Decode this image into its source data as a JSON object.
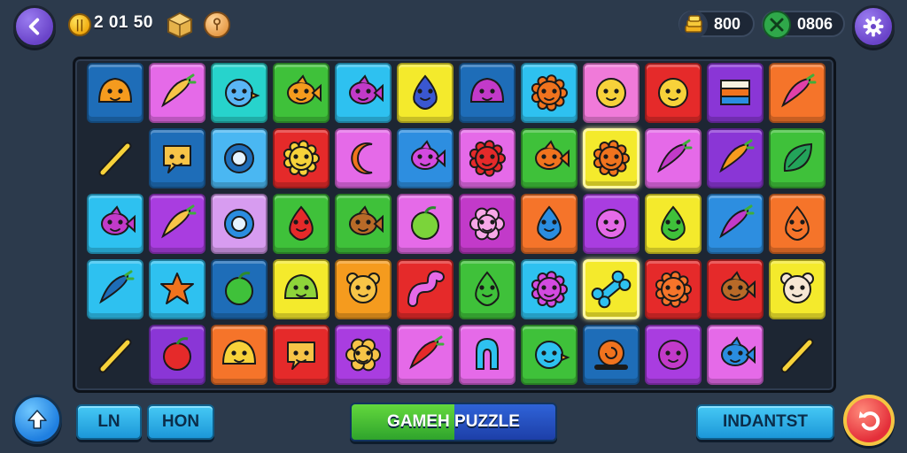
{
  "header": {
    "score": "2 01 50",
    "gems": "800",
    "energy": "0806",
    "coin_icon": "coin-icon",
    "box_icon": "treasure-box-icon",
    "key_icon": "key-coin-icon"
  },
  "buttons": {
    "ln": "LN",
    "hon": "HON",
    "puzzle": "GAMEH PUZZLE",
    "instant": "INDANTST"
  },
  "colors": {
    "accent_purple": "#6a44c9",
    "board": "#1d2633",
    "background": "#2c3a4c"
  },
  "board": {
    "rows": 5,
    "cols": 12,
    "tiles": [
      [
        {
          "c": "#1e6db8",
          "i": "blob",
          "f": "#f59b1e"
        },
        {
          "c": "#e56ae8",
          "i": "carrot",
          "f": "#f7c447"
        },
        {
          "c": "#27d3cc",
          "i": "bird",
          "f": "#5ab6f5"
        },
        {
          "c": "#3fc13a",
          "i": "fish",
          "f": "#f59b1e"
        },
        {
          "c": "#2ec1f0",
          "i": "fish",
          "f": "#c23ac9"
        },
        {
          "c": "#f4ea2c",
          "i": "drop",
          "f": "#3a57d1"
        },
        {
          "c": "#1e6db8",
          "i": "blob",
          "f": "#c23ac9"
        },
        {
          "c": "#2ec1f0",
          "i": "sun",
          "f": "#f0731e"
        },
        {
          "c": "#f07ad9",
          "i": "face",
          "f": "#f7d23a"
        },
        {
          "c": "#e52a2a",
          "i": "face",
          "f": "#f7d23a"
        },
        {
          "c": "#8a36d6",
          "i": "flag",
          "f": "#f0731e"
        },
        {
          "c": "#f5742a",
          "i": "carrot",
          "f": "#e040a8"
        }
      ],
      [
        null,
        {
          "c": "#1e6db8",
          "i": "chat",
          "f": "#f7c447"
        },
        {
          "c": "#4ab7f2",
          "i": "ring",
          "f": "#1e6db8"
        },
        {
          "c": "#e52a2a",
          "i": "sun",
          "f": "#f7d23a"
        },
        {
          "c": "#e56ae8",
          "i": "moon",
          "f": "#f0731e"
        },
        {
          "c": "#2d8ee0",
          "i": "fish",
          "f": "#d34ae0"
        },
        {
          "c": "#e56ae8",
          "i": "sun",
          "f": "#e52a2a"
        },
        {
          "c": "#3fc13a",
          "i": "fish",
          "f": "#f0731e"
        },
        {
          "c": "#f4ea2c",
          "i": "sun",
          "f": "#f0731e",
          "hl": true
        },
        {
          "c": "#e56ae8",
          "i": "carrot",
          "f": "#c23ac9"
        },
        {
          "c": "#8a36d6",
          "i": "carrot",
          "f": "#f59b1e"
        },
        {
          "c": "#3fc13a",
          "i": "leaf",
          "f": "#23a35a"
        }
      ],
      [
        {
          "c": "#2ec1f0",
          "i": "fish",
          "f": "#c23ac9"
        },
        {
          "c": "#a93de0",
          "i": "carrot",
          "f": "#f7c447"
        },
        {
          "c": "#d79cf0",
          "i": "ring",
          "f": "#2a8de0"
        },
        {
          "c": "#3fc13a",
          "i": "drop",
          "f": "#e52a2a"
        },
        {
          "c": "#3fc13a",
          "i": "fish",
          "f": "#b86a28"
        },
        {
          "c": "#e56ae8",
          "i": "apple",
          "f": "#7bd43a"
        },
        {
          "c": "#c23ac9",
          "i": "flower",
          "f": "#f7a8e8"
        },
        {
          "c": "#f5742a",
          "i": "drop",
          "f": "#2a8de0"
        },
        {
          "c": "#a93de0",
          "i": "face",
          "f": "#e56ae8"
        },
        {
          "c": "#f4ea2c",
          "i": "drop",
          "f": "#3fc13a"
        },
        {
          "c": "#2d8ee0",
          "i": "carrot",
          "f": "#c23ac9"
        },
        {
          "c": "#f5742a",
          "i": "drop",
          "f": "#f5742a"
        }
      ],
      [
        {
          "c": "#2ec1f0",
          "i": "carrot",
          "f": "#1e6db8"
        },
        {
          "c": "#2ec1f0",
          "i": "star",
          "f": "#f0731e"
        },
        {
          "c": "#1e6db8",
          "i": "apple",
          "f": "#3fc13a"
        },
        {
          "c": "#f4ea2c",
          "i": "blob",
          "f": "#8ed43a"
        },
        {
          "c": "#f59b1e",
          "i": "bear",
          "f": "#f7c447"
        },
        {
          "c": "#e52a2a",
          "i": "snake",
          "f": "#e56ae8"
        },
        {
          "c": "#3fc13a",
          "i": "drop",
          "f": "#3fc13a"
        },
        {
          "c": "#2ec1f0",
          "i": "sun",
          "f": "#d34ae0"
        },
        {
          "c": "#f4ea2c",
          "i": "bone",
          "f": "#2ec1f0",
          "hl": true
        },
        {
          "c": "#e52a2a",
          "i": "sun",
          "f": "#f5742a"
        },
        {
          "c": "#e52a2a",
          "i": "fish",
          "f": "#b86a28"
        },
        {
          "c": "#f4ea2c",
          "i": "bear",
          "f": "#f6e7d4"
        }
      ],
      [
        null,
        {
          "c": "#8a36d6",
          "i": "apple",
          "f": "#e52a2a"
        },
        {
          "c": "#f5742a",
          "i": "blob",
          "f": "#f7d23a"
        },
        {
          "c": "#e52a2a",
          "i": "chat",
          "f": "#f7c447"
        },
        {
          "c": "#a93de0",
          "i": "flower",
          "f": "#f7c447"
        },
        {
          "c": "#e56ae8",
          "i": "carrot",
          "f": "#e52a2a"
        },
        {
          "c": "#e56ae8",
          "i": "arch",
          "f": "#2ec1f0"
        },
        {
          "c": "#3fc13a",
          "i": "bird",
          "f": "#2ec1f0"
        },
        {
          "c": "#1e6db8",
          "i": "snail",
          "f": "#f0731e"
        },
        {
          "c": "#a93de0",
          "i": "face",
          "f": "#c23ac9"
        },
        {
          "c": "#e56ae8",
          "i": "fish",
          "f": "#2a8de0"
        },
        null
      ]
    ],
    "sticks": [
      [
        1,
        0
      ],
      [
        4,
        0
      ],
      [
        4,
        11
      ]
    ]
  }
}
